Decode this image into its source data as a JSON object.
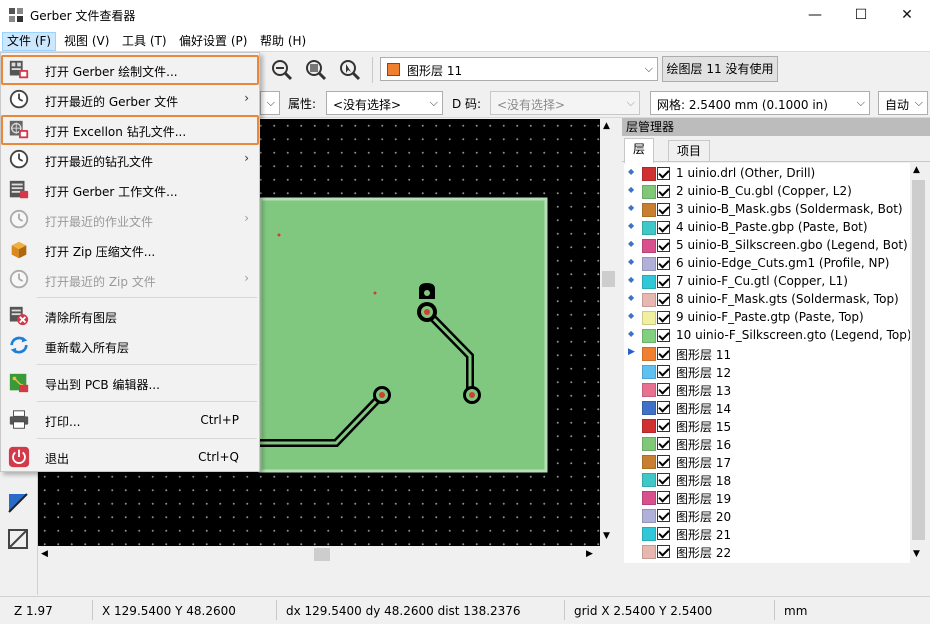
{
  "window": {
    "title": "Gerber 文件查看器",
    "minimize": "—",
    "maximize": "☐",
    "close": "✕"
  },
  "menubar": {
    "items": [
      "文件 (F)",
      "视图 (V)",
      "工具 (T)",
      "偏好设置 (P)",
      "帮助 (H)"
    ]
  },
  "toolbar": {
    "active_layer": "图形层 11",
    "active_layer_color": "#f08030",
    "layer_status_button": "绘图层 11 没有使用",
    "attribute_label": "属性:",
    "attribute_value": "<没有选择>",
    "dcode_label": "D 码:",
    "dcode_value": "<没有选择>",
    "grid_value": "网格: 2.5400 mm (0.1000 in)",
    "zoom_value": "自动"
  },
  "file_menu": {
    "items": [
      {
        "label": "打开 Gerber 绘制文件...",
        "icon": "gerber-open-icon",
        "highlight": true
      },
      {
        "label": "打开最近的 Gerber 文件",
        "icon": "recent-clock-icon",
        "submenu": true
      },
      {
        "label": "打开 Excellon 钻孔文件...",
        "icon": "drill-open-icon",
        "highlight": true
      },
      {
        "label": "打开最近的钻孔文件",
        "icon": "recent-clock-icon",
        "submenu": true
      },
      {
        "label": "打开 Gerber 工作文件...",
        "icon": "job-file-icon"
      },
      {
        "label": "打开最近的作业文件",
        "icon": "recent-clock-icon",
        "submenu": true,
        "disabled": true
      },
      {
        "label": "打开 Zip 压缩文件...",
        "icon": "zip-icon"
      },
      {
        "label": "打开最近的 Zip 文件",
        "icon": "recent-clock-icon",
        "submenu": true,
        "disabled": true
      },
      {
        "label": "清除所有图层",
        "icon": "clear-layers-icon"
      },
      {
        "label": "重新载入所有层",
        "icon": "reload-icon"
      },
      {
        "label": "导出到 PCB 编辑器...",
        "icon": "export-pcb-icon"
      },
      {
        "label": "打印...",
        "shortcut": "Ctrl+P",
        "icon": "print-icon"
      },
      {
        "label": "退出",
        "shortcut": "Ctrl+Q",
        "icon": "exit-icon"
      }
    ]
  },
  "layer_manager": {
    "title": "层管理器",
    "tabs": [
      "层",
      "项目"
    ],
    "layers": [
      {
        "name": "1 uinio.drl (Other, Drill)",
        "color": "#d03030",
        "marker": "◆"
      },
      {
        "name": "2 uinio-B_Cu.gbl (Copper, L2)",
        "color": "#80c878",
        "marker": "◆"
      },
      {
        "name": "3 uinio-B_Mask.gbs (Soldermask, Bot)",
        "color": "#c88030",
        "marker": "◆"
      },
      {
        "name": "4 uinio-B_Paste.gbp (Paste, Bot)",
        "color": "#40c8c8",
        "marker": "◆"
      },
      {
        "name": "5 uinio-B_Silkscreen.gbo (Legend, Bot)",
        "color": "#d8508c",
        "marker": "◆"
      },
      {
        "name": "6 uinio-Edge_Cuts.gm1 (Profile, NP)",
        "color": "#b0b0d8",
        "marker": "◆"
      },
      {
        "name": "7 uinio-F_Cu.gtl (Copper, L1)",
        "color": "#30c8d8",
        "marker": "◆"
      },
      {
        "name": "8 uinio-F_Mask.gts (Soldermask, Top)",
        "color": "#e8b8b0",
        "marker": "◆"
      },
      {
        "name": "9 uinio-F_Paste.gtp (Paste, Top)",
        "color": "#f0f0a0",
        "marker": "◆"
      },
      {
        "name": "10 uinio-F_Silkscreen.gto (Legend, Top)",
        "color": "#80d080",
        "marker": "◆"
      },
      {
        "name": "图形层 11",
        "color": "#f08030",
        "marker": "▶"
      },
      {
        "name": "图形层 12",
        "color": "#60c0f0",
        "marker": ""
      },
      {
        "name": "图形层 13",
        "color": "#e87090",
        "marker": ""
      },
      {
        "name": "图形层 14",
        "color": "#4070c8",
        "marker": ""
      },
      {
        "name": "图形层 15",
        "color": "#d03030",
        "marker": ""
      },
      {
        "name": "图形层 16",
        "color": "#80c878",
        "marker": ""
      },
      {
        "name": "图形层 17",
        "color": "#c88030",
        "marker": ""
      },
      {
        "name": "图形层 18",
        "color": "#40c8c8",
        "marker": ""
      },
      {
        "name": "图形层 19",
        "color": "#d8508c",
        "marker": ""
      },
      {
        "name": "图形层 20",
        "color": "#b0b0d8",
        "marker": ""
      },
      {
        "name": "图形层 21",
        "color": "#30c8d8",
        "marker": ""
      },
      {
        "name": "图形层 22",
        "color": "#e8b8b0",
        "marker": ""
      }
    ]
  },
  "statusbar": {
    "zoom": "Z 1.97",
    "cursor": "X 129.5400  Y 48.2600",
    "delta": "dx 129.5400  dy 48.2600  dist 138.2376",
    "grid": "grid X 2.5400  Y 2.5400",
    "units": "mm"
  },
  "colors": {
    "board_fill": "#80c880",
    "pad_dot": "#d04030",
    "highlight_outline": "#e8883a"
  }
}
